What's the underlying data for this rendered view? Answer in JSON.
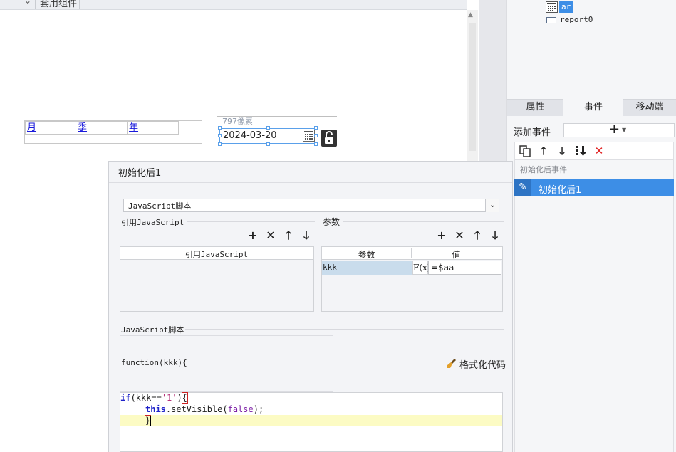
{
  "canvas": {
    "top_label": "套用组件",
    "tabs": [
      "月",
      "季",
      "年"
    ],
    "size_label": "797像素",
    "date_value": "2024-03-20"
  },
  "tree": {
    "items": [
      {
        "label": "ar",
        "icon": "calendar-icon"
      },
      {
        "label": "report0",
        "icon": "report-icon"
      }
    ]
  },
  "right_tabs": [
    "属性",
    "事件",
    "移动端"
  ],
  "events": {
    "add_label": "添加事件",
    "group_label": "初始化后事件",
    "item_label": "初始化后1"
  },
  "dialog": {
    "title": "初始化后1",
    "script_type": "JavaScript脚本",
    "ref_section": "引用JavaScript",
    "ref_column": "引用JavaScript",
    "param_section": "参数",
    "param_columns": [
      "参数",
      "值"
    ],
    "params": [
      {
        "name": "kkk",
        "value": "=$aa"
      }
    ],
    "fx_label": "F(x)",
    "script_section": "JavaScript脚本",
    "function_signature": "function(kkk){",
    "format_button": "格式化代码",
    "code": {
      "l1_kw": "if",
      "l1_open": "(kkk==",
      "l1_str": "'1'",
      "l1_close": ")",
      "l1_brace": "{",
      "l2_this": "this",
      "l2_call": ".setVisible(",
      "l2_bool": "false",
      "l2_end": ");",
      "l3_brace": "}"
    }
  },
  "colors": {
    "accent": "#3d8ee6",
    "delete_red": "#e02020",
    "highlight_row": "#c9dcec",
    "code_line_highlight": "#fcfbc4"
  }
}
